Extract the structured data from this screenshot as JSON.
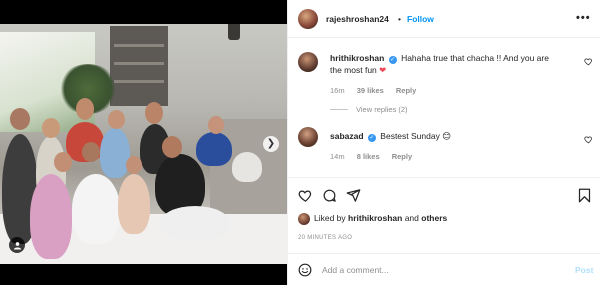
{
  "post": {
    "username": "rajeshroshan24",
    "follow_label": "Follow",
    "separator": "•",
    "more": "•••"
  },
  "comments": [
    {
      "username": "hrithikroshan",
      "text": "Hahaha true that chacha !! And you are the most fun",
      "emoji": "❤",
      "time": "16m",
      "likes": "39 likes",
      "reply_label": "Reply"
    },
    {
      "username": "sabazad",
      "text": "Bestest Sunday",
      "emoji": "😊",
      "time": "14m",
      "likes": "8 likes",
      "reply_label": "Reply"
    }
  ],
  "view_replies": "View replies (2)",
  "liked_by": {
    "prefix": "Liked by ",
    "user": "hrithikroshan",
    "middle": " and ",
    "others": "others"
  },
  "timestamp": "20 MINUTES AGO",
  "add_comment": {
    "placeholder": "Add a comment...",
    "post_label": "Post"
  },
  "icons": {
    "heart": "heart-icon",
    "comment": "comment-icon",
    "share": "share-icon",
    "save": "bookmark-icon",
    "emoji": "smiley-icon",
    "next": "chevron-right-icon",
    "tag": "user-tag-icon"
  },
  "colors": {
    "accent": "#0095f6",
    "verified": "#3897f0",
    "heart_emoji": "#ed4956",
    "muted": "#8e8e8e"
  }
}
